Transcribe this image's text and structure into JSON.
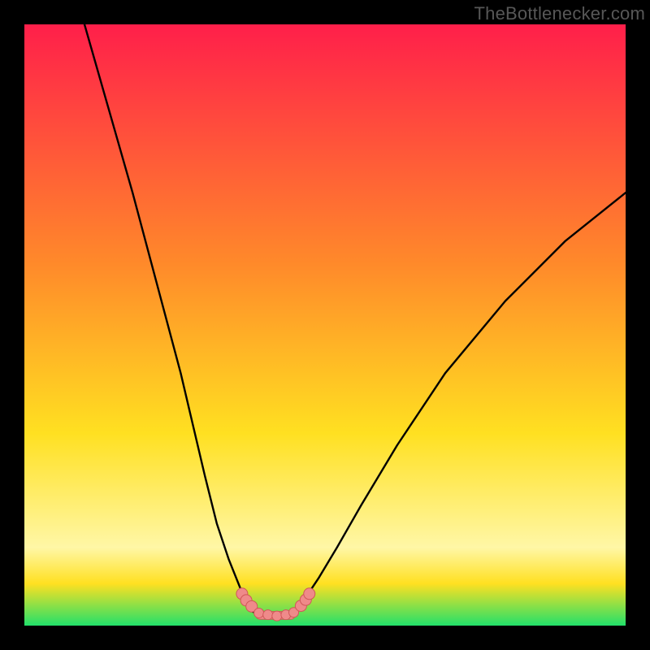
{
  "watermark": "TheBottlenecker.com",
  "colors": {
    "bg": "#000000",
    "gradient_top": "#ff1f4a",
    "gradient_mid_upper": "#ff8a2a",
    "gradient_mid": "#ffe021",
    "gradient_band_light": "#fff7a6",
    "gradient_bottom": "#22e06a",
    "curve": "#000000",
    "marker_fill": "#ef8a8a",
    "marker_stroke": "#d05858"
  },
  "chart_data": {
    "type": "line",
    "title": "",
    "xlabel": "",
    "ylabel": "",
    "xlim": [
      0,
      100
    ],
    "ylim": [
      0,
      100
    ],
    "series": [
      {
        "name": "left-branch",
        "x": [
          10,
          14,
          18,
          22,
          26,
          30,
          32,
          34,
          36,
          36.5,
          37,
          38,
          39
        ],
        "y": [
          100,
          86,
          72,
          57,
          42,
          25,
          17,
          11,
          6,
          4.5,
          3.5,
          2.3,
          2
        ]
      },
      {
        "name": "valley-floor",
        "x": [
          39,
          41,
          43,
          45
        ],
        "y": [
          2,
          1.6,
          1.6,
          2
        ]
      },
      {
        "name": "right-branch",
        "x": [
          45,
          46,
          47,
          49,
          52,
          56,
          62,
          70,
          80,
          90,
          100
        ],
        "y": [
          2,
          3.5,
          5,
          8,
          13,
          20,
          30,
          42,
          54,
          64,
          72
        ]
      }
    ],
    "markers": {
      "name": "highlighted-points",
      "x": [
        36.2,
        36.9,
        37.8,
        39.0,
        40.5,
        42.0,
        43.5,
        44.8,
        46.0,
        46.8,
        47.4
      ],
      "y": [
        5.3,
        4.2,
        3.2,
        2.1,
        1.8,
        1.6,
        1.8,
        2.2,
        3.3,
        4.3,
        5.3
      ],
      "r": [
        7,
        7,
        7,
        6,
        6,
        6,
        6,
        6,
        7,
        7,
        7
      ]
    },
    "floor_strip": {
      "x0": 38.5,
      "x1": 45.0,
      "y": 1.7,
      "height": 1.3
    }
  }
}
